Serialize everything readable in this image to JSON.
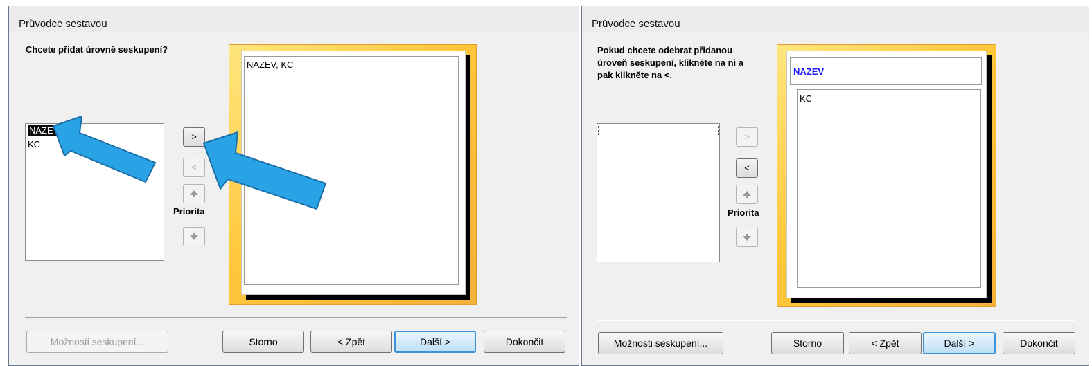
{
  "left": {
    "title": "Průvodce sestavou",
    "prompt": "Chcete přidat úrovně seskupení?",
    "fields": [
      "NAZEV",
      "KC"
    ],
    "add_btn": ">",
    "remove_btn": "<",
    "up_icon": "arrow-up-icon",
    "down_icon": "arrow-down-icon",
    "priority_label": "Priorita",
    "preview_text": "NAZEV, KC",
    "buttons": {
      "grouping_options": "Možnosti seskupení...",
      "cancel": "Storno",
      "back": "< Zpět",
      "next": "Další >",
      "finish": "Dokončit"
    }
  },
  "right": {
    "title": "Průvodce sestavou",
    "prompt": "Pokud chcete odebrat přidanou úroveň seskupení, klikněte na ni a pak klikněte na <.",
    "add_btn": ">",
    "remove_btn": "<",
    "priority_label": "Priorita",
    "preview_group": "NAZEV",
    "preview_detail": "KC",
    "buttons": {
      "grouping_options": "Možnosti seskupení...",
      "cancel": "Storno",
      "back": "< Zpět",
      "next": "Další >",
      "finish": "Dokončit"
    }
  },
  "colors": {
    "arrow": "#2aa3e6",
    "group_text": "#1a1aff",
    "selection": "#0a0a0a"
  }
}
